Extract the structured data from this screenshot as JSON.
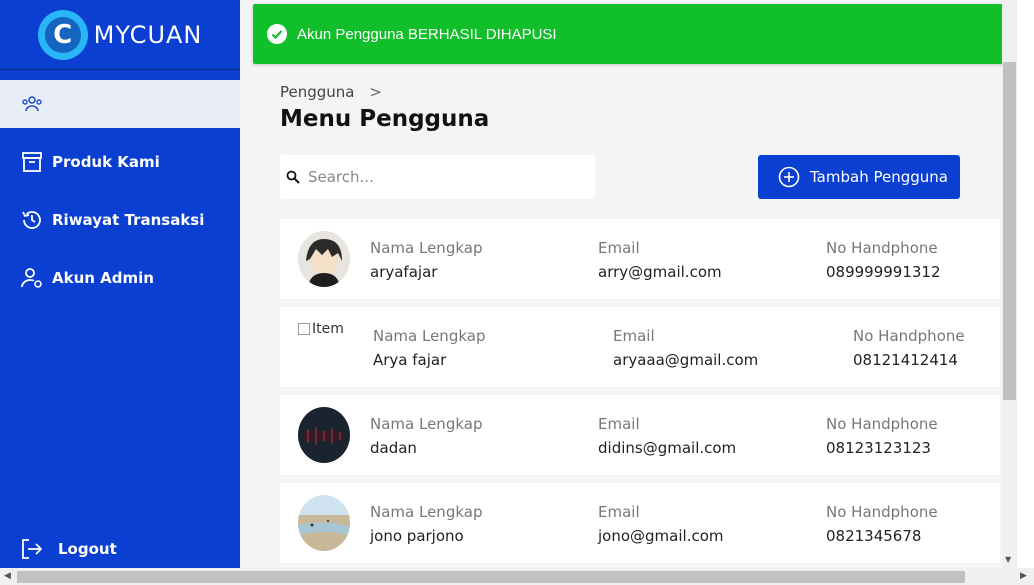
{
  "app": {
    "logo_letter": "C",
    "logo_text": "MYCUAN"
  },
  "sidebar": {
    "items": [
      {
        "label": "Pengguna",
        "icon": "users-icon",
        "active": true
      },
      {
        "label": "Produk Kami",
        "icon": "archive-box-icon",
        "active": false
      },
      {
        "label": "Riwayat Transaksi",
        "icon": "history-clock-icon",
        "active": false
      },
      {
        "label": "Akun Admin",
        "icon": "user-gear-icon",
        "active": false
      }
    ],
    "logout_label": "Logout"
  },
  "toast": {
    "message": "Akun Pengguna BERHASIL DIHAPUSI",
    "color": "#11bf2b"
  },
  "breadcrumb": {
    "item": "Pengguna",
    "separator": ">"
  },
  "page_title": "Menu Pengguna",
  "search": {
    "placeholder": "Search...",
    "value": ""
  },
  "add_button": {
    "label": "Tambah Pengguna"
  },
  "users": [
    {
      "name_label": "Nama Lengkap",
      "name": "aryafajar",
      "email_label": "Email",
      "email": "arry@gmail.com",
      "phone_label": "No Handphone",
      "phone": "089999991312",
      "avatar": "anime-boy"
    },
    {
      "name_label": "Nama Lengkap",
      "name": "Arya fajar",
      "email_label": "Email",
      "email": "aryaaa@gmail.com",
      "phone_label": "No Handphone",
      "phone": "08121412414",
      "avatar_alt": "Item"
    },
    {
      "name_label": "Nama Lengkap",
      "name": "dadan",
      "email_label": "Email",
      "email": "didins@gmail.com",
      "phone_label": "No Handphone",
      "phone": "08123123123",
      "avatar": "dark-photo"
    },
    {
      "name_label": "Nama Lengkap",
      "name": "jono parjono",
      "email_label": "Email",
      "email": "jono@gmail.com",
      "phone_label": "No Handphone",
      "phone": "0821345678",
      "avatar": "beach-photo"
    }
  ],
  "colors": {
    "primary": "#0a3fd1",
    "success": "#11bf2b"
  }
}
